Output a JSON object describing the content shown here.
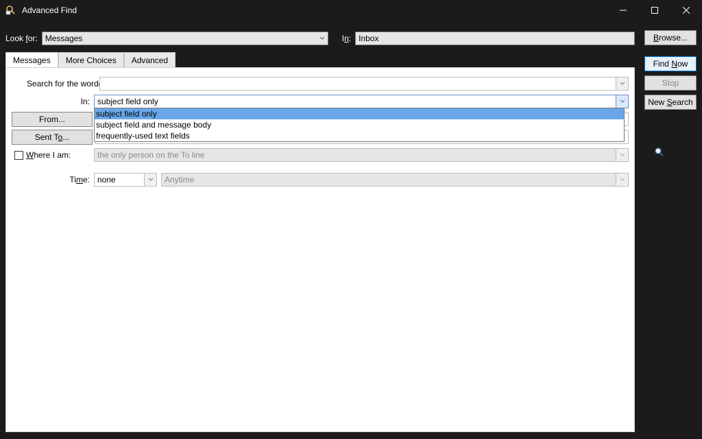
{
  "window": {
    "title": "Advanced Find"
  },
  "toprow": {
    "lookfor_label_pre": "Look ",
    "lookfor_label_u": "f",
    "lookfor_label_post": "or:",
    "lookfor_value": "Messages",
    "in_label_pre": "I",
    "in_label_u": "n",
    "in_label_post": ":",
    "in_value": "Inbox",
    "browse_u": "B",
    "browse_rest": "rowse..."
  },
  "side": {
    "findnow_pre": "Find ",
    "findnow_u": "N",
    "findnow_post": "ow",
    "stop": "Stop",
    "newsearch_pre": "New ",
    "newsearch_u": "S",
    "newsearch_post": "earch"
  },
  "tabs": {
    "messages": "Messages",
    "more": "More Choices",
    "advanced": "Advanced"
  },
  "form": {
    "search_label": "Search for the word(s):",
    "in_label": "In:",
    "in_value": "subject field only",
    "from_label": "From...",
    "sentto_pre": "Sent T",
    "sentto_u": "o",
    "sentto_post": "...",
    "where_pre": "",
    "where_u": "W",
    "where_post": "here I am:",
    "where_value": "the only person on the To line",
    "time_pre": "Ti",
    "time_u": "m",
    "time_post": "e:",
    "time_value": "none",
    "time_grey": "Anytime"
  },
  "dropdown": {
    "options": [
      "subject field only",
      "subject field and message body",
      "frequently-used text fields"
    ]
  }
}
